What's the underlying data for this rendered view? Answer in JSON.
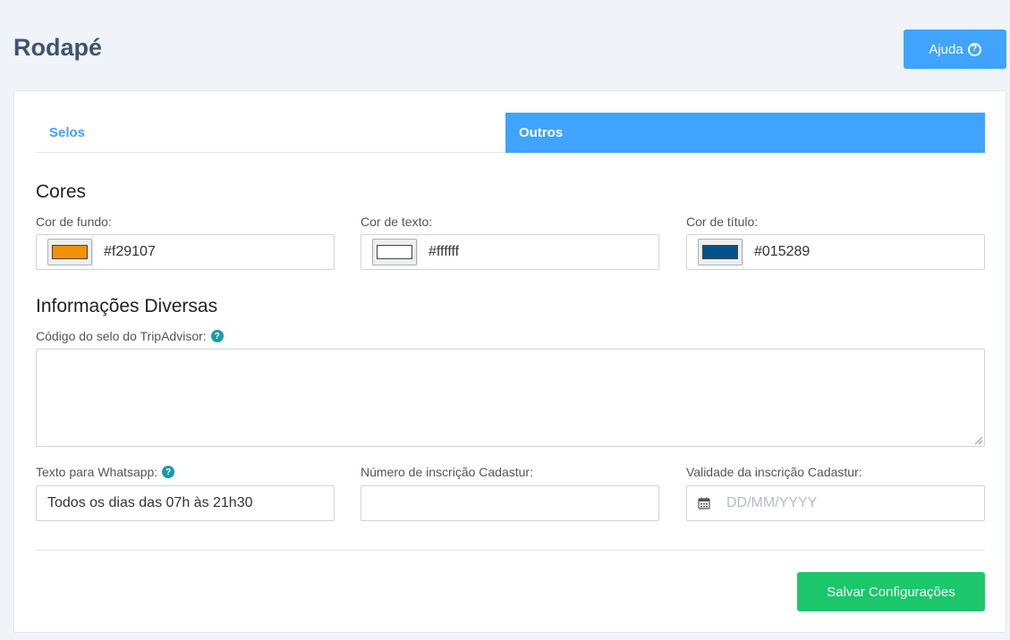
{
  "page": {
    "title": "Rodapé"
  },
  "header": {
    "help_label": "Ajuda",
    "help_icon": "question-circle-icon"
  },
  "tabs": [
    {
      "label": "Selos",
      "active": false
    },
    {
      "label": "Outros",
      "active": true
    }
  ],
  "colors_section": {
    "title": "Cores",
    "fields": [
      {
        "label": "Cor de fundo:",
        "value": "#f29107",
        "swatch": "#f29107"
      },
      {
        "label": "Cor de texto:",
        "value": "#ffffff",
        "swatch": "#ffffff"
      },
      {
        "label": "Cor de título:",
        "value": "#015289",
        "swatch": "#015289"
      }
    ]
  },
  "info_section": {
    "title": "Informações Diversas",
    "tripadvisor_label": "Código do selo do TripAdvisor:",
    "tripadvisor_value": "",
    "whatsapp_label": "Texto para Whatsapp:",
    "whatsapp_value": "Todos os dias das 07h às 21h30",
    "cadastur_number_label": "Número de inscrição Cadastur:",
    "cadastur_number_value": "",
    "cadastur_validity_label": "Validade da inscrição Cadastur:",
    "cadastur_validity_placeholder": "DD/MM/YYYY"
  },
  "footer": {
    "save_label": "Salvar Configurações"
  },
  "theme": {
    "accent": "#40a3fc",
    "title_color": "#3d5573",
    "success": "#1cc76b",
    "info_icon": "#1b9aa8"
  }
}
